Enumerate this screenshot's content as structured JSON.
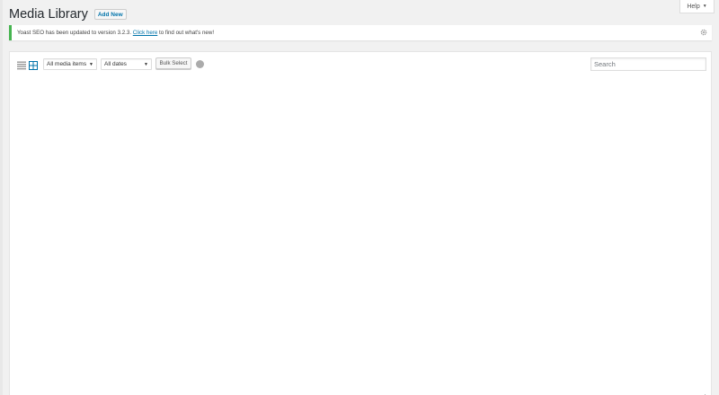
{
  "help_tab": {
    "label": "Help"
  },
  "header": {
    "title": "Media Library",
    "add_new_label": "Add New"
  },
  "notice": {
    "text_before": "Yoast SEO has been updated to version 3.2.3. ",
    "link_text": "Click here",
    "text_after": " to find out what's new!",
    "accent_color": "#46b450"
  },
  "toolbar": {
    "list_view_icon": "list-view-icon",
    "grid_view_icon": "grid-view-icon",
    "type_filter": {
      "selected": "All media items"
    },
    "date_filter": {
      "selected": "All dates"
    },
    "bulk_select_label": "Bulk Select",
    "search": {
      "placeholder": "Search",
      "value": ""
    }
  },
  "colors": {
    "link": "#0073aa",
    "background": "#f1f1f1"
  }
}
